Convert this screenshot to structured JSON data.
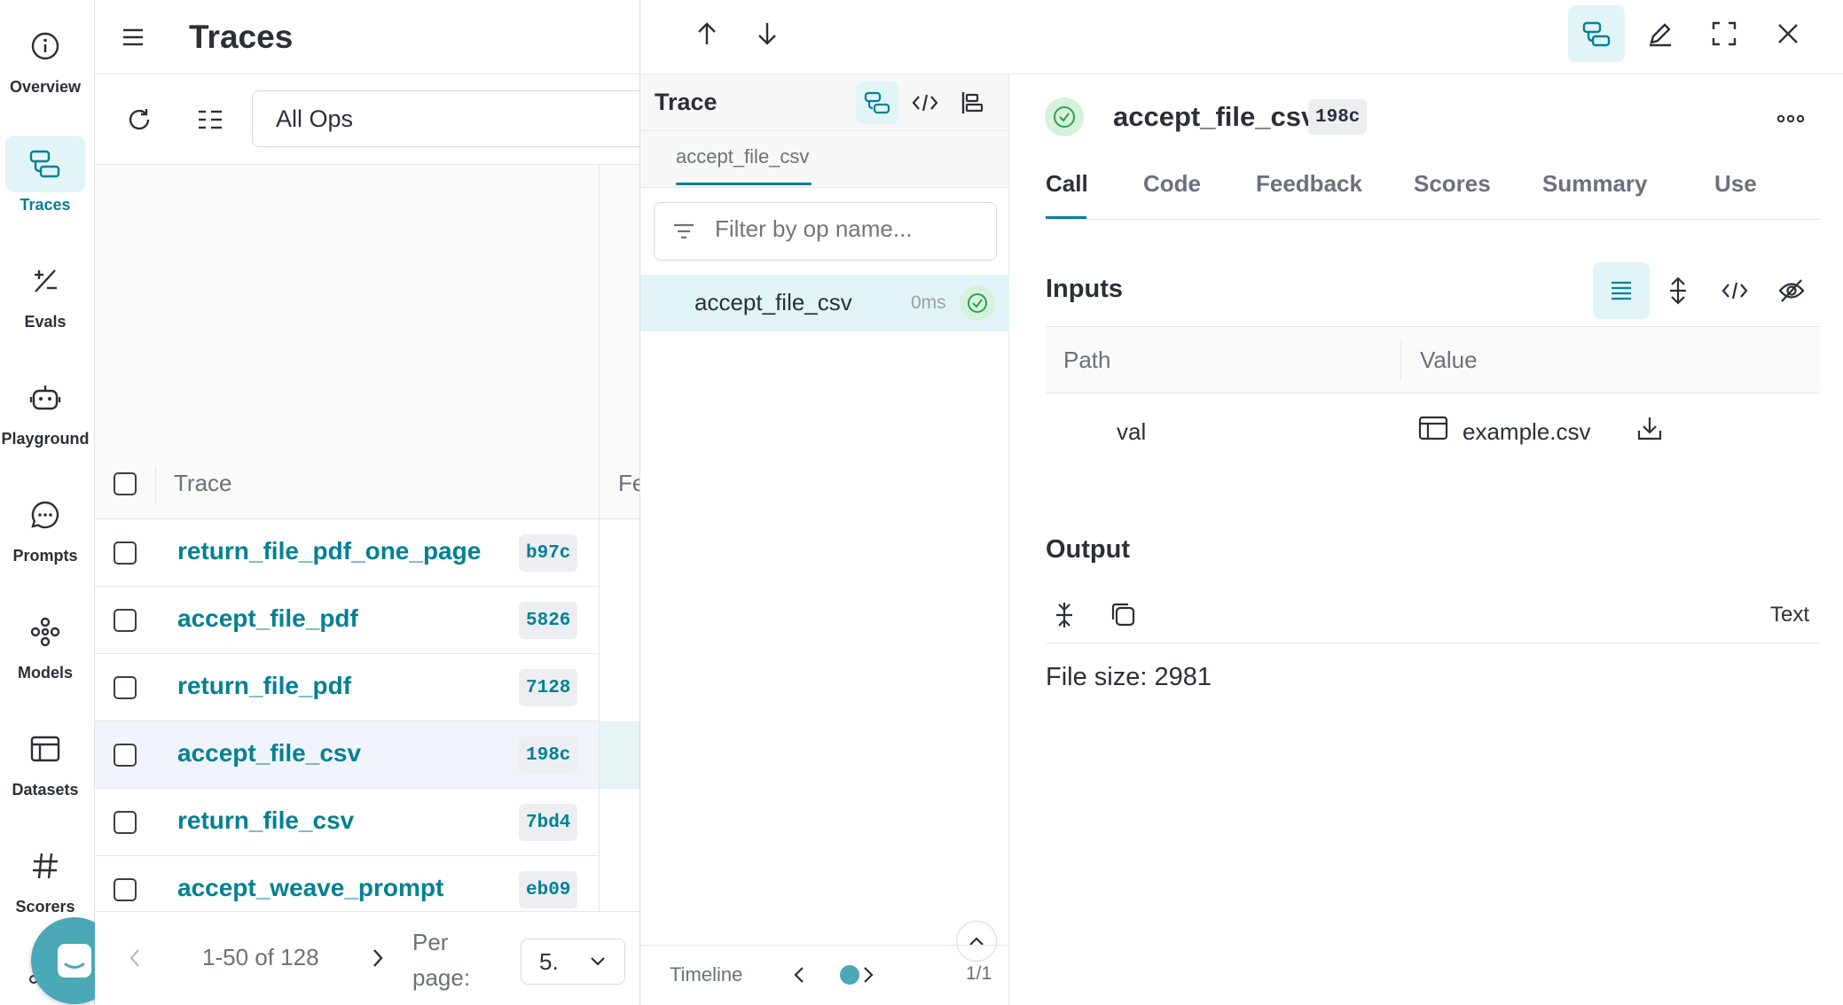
{
  "nav": {
    "items": [
      {
        "label": "Overview",
        "icon": "info-icon"
      },
      {
        "label": "Traces",
        "icon": "traces-icon",
        "active": true
      },
      {
        "label": "Evals",
        "icon": "evals-icon"
      },
      {
        "label": "Playground",
        "icon": "robot-icon"
      },
      {
        "label": "Prompts",
        "icon": "chat-bubble-icon"
      },
      {
        "label": "Models",
        "icon": "model-icon"
      },
      {
        "label": "Datasets",
        "icon": "table-icon"
      },
      {
        "label": "Scorers",
        "icon": "hash-icon"
      }
    ]
  },
  "list": {
    "title": "Traces",
    "ops_filter": "All Ops",
    "columns": {
      "trace": "Trace",
      "feedback": "Fe"
    },
    "rows": [
      {
        "name": "return_file_pdf_one_page",
        "hash": "b97c",
        "selected": false
      },
      {
        "name": "accept_file_pdf",
        "hash": "5826",
        "selected": false
      },
      {
        "name": "return_file_pdf",
        "hash": "7128",
        "selected": false
      },
      {
        "name": "accept_file_csv",
        "hash": "198c",
        "selected": true
      },
      {
        "name": "return_file_csv",
        "hash": "7bd4",
        "selected": false
      },
      {
        "name": "accept_weave_prompt",
        "hash": "eb09",
        "selected": false
      }
    ],
    "pager": {
      "range": "1-50 of 128",
      "per_page_label": "Per page:",
      "per_page_value": "5."
    }
  },
  "tree": {
    "title": "Trace",
    "tab": "accept_file_csv",
    "filter_placeholder": "Filter by op name...",
    "node": {
      "name": "accept_file_csv",
      "duration": "0ms"
    },
    "timeline_label": "Timeline",
    "timeline_count": "1/1"
  },
  "call": {
    "title": "accept_file_csv",
    "hash": "198c",
    "tabs": [
      "Call",
      "Code",
      "Feedback",
      "Scores",
      "Summary",
      "Use"
    ],
    "active_tab": "Call",
    "inputs": {
      "heading": "Inputs",
      "col_path": "Path",
      "col_value": "Value",
      "rows": [
        {
          "key": "val",
          "value": "example.csv"
        }
      ]
    },
    "output": {
      "heading": "Output",
      "mode": "Text",
      "text": "File size: 2981"
    }
  },
  "colors": {
    "accent": "#038194",
    "accent_bg": "#e1f4f7",
    "success": "#2e9e4f"
  }
}
